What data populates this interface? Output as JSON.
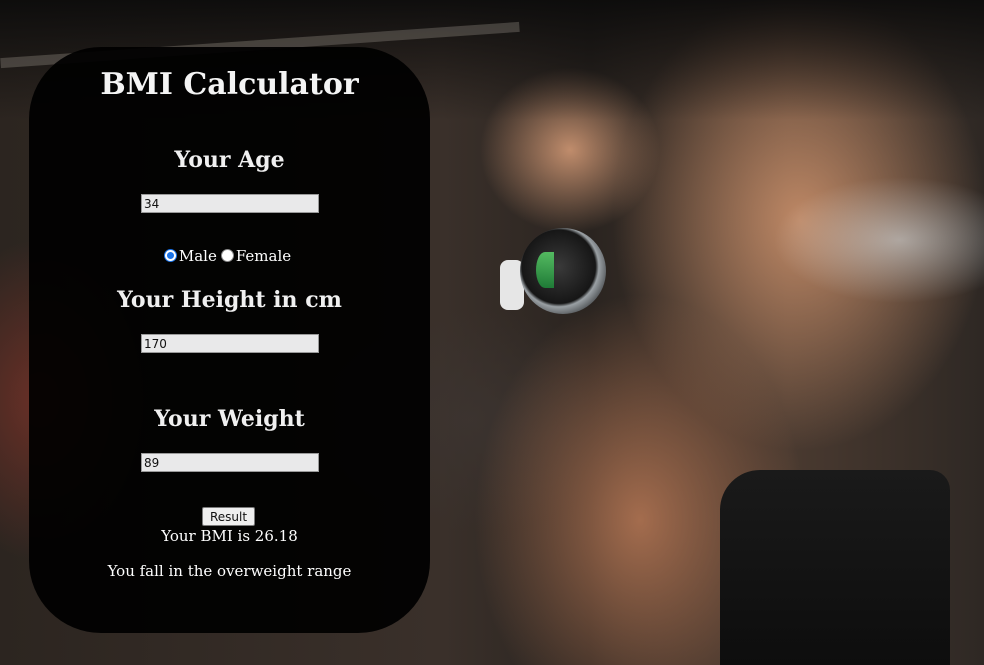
{
  "calculator": {
    "title": "BMI Calculator",
    "age": {
      "label": "Your Age",
      "value": "34"
    },
    "gender": {
      "options": [
        {
          "label": "Male",
          "selected": true
        },
        {
          "label": "Female",
          "selected": false
        }
      ]
    },
    "height": {
      "label": "Your Height in cm",
      "value": "170"
    },
    "weight": {
      "label": "Your Weight",
      "value": "89"
    },
    "result_button_label": "Result",
    "bmi_text": "Your BMI is 26.18",
    "range_text": "You fall in the overweight range"
  },
  "colors": {
    "panel_background": "#000000",
    "text": "#ffffff",
    "radio_accent": "#1a73e8",
    "input_background": "#e9e9ea"
  }
}
